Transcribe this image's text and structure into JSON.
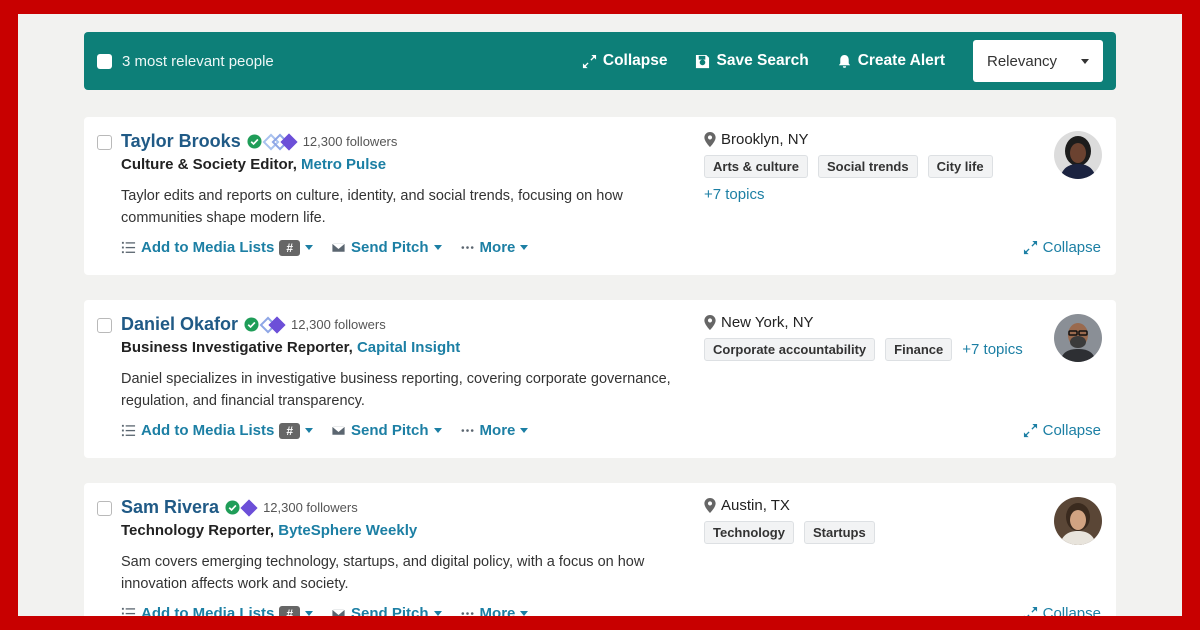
{
  "toolbar": {
    "count_label": "3 most relevant people",
    "collapse_label": "Collapse",
    "save_search_label": "Save Search",
    "create_alert_label": "Create Alert",
    "sort_value": "Relevancy"
  },
  "colors": {
    "accent": "#0d7f78",
    "link": "#1c7fa4",
    "name": "#205a86",
    "frame": "#c80000"
  },
  "people": [
    {
      "name": "Taylor Brooks",
      "followers": "12,300 followers",
      "role": "Culture & Society Editor,",
      "outlet": "Metro Pulse",
      "bio": "Taylor edits and reports on culture, identity, and social trends, focusing on how communities shape modern life.",
      "location": "Brooklyn, NY",
      "topics": [
        "Arts & culture",
        "Social trends",
        "City life"
      ],
      "more_topics": "+7 topics",
      "add_lists_label": "Add to Media Lists",
      "list_badge": "#",
      "send_pitch_label": "Send Pitch",
      "more_label": "More",
      "collapse_label": "Collapse"
    },
    {
      "name": "Daniel Okafor",
      "followers": "12,300 followers",
      "role": "Business Investigative Reporter,",
      "outlet": "Capital Insight",
      "bio": "Daniel specializes in investigative business reporting, covering corporate governance, regulation, and financial transparency.",
      "location": "New York, NY",
      "topics": [
        "Corporate accountability",
        "Finance"
      ],
      "more_topics": "+7 topics",
      "add_lists_label": "Add to Media Lists",
      "list_badge": "#",
      "send_pitch_label": "Send Pitch",
      "more_label": "More",
      "collapse_label": "Collapse"
    },
    {
      "name": "Sam Rivera",
      "followers": "12,300 followers",
      "role": "Technology Reporter,",
      "outlet": "ByteSphere Weekly",
      "bio": "Sam covers emerging technology, startups, and digital policy, with a focus on how innovation affects work and society.",
      "location": "Austin, TX",
      "topics": [
        "Technology",
        "Startups"
      ],
      "more_topics": "",
      "add_lists_label": "Add to Media Lists",
      "list_badge": "#",
      "send_pitch_label": "Send Pitch",
      "more_label": "More",
      "collapse_label": "Collapse"
    }
  ]
}
